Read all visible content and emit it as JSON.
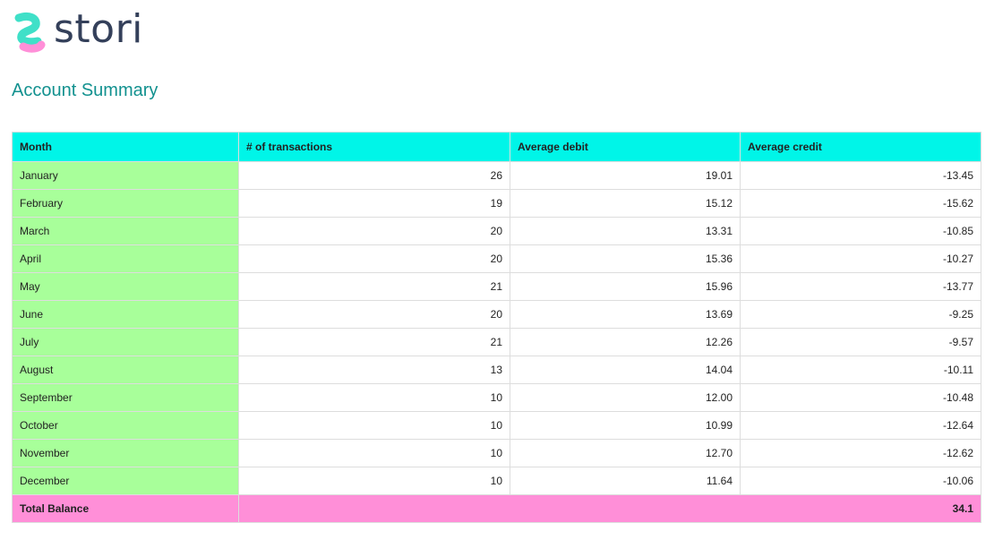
{
  "brand": {
    "name": "stori",
    "text_color": "#34405a",
    "logo_colors": [
      "#3fe0c8",
      "#ff8fd8",
      "#7b61ff"
    ]
  },
  "page": {
    "title": "Account Summary",
    "title_color": "#12918f"
  },
  "table": {
    "header_bg": "#00f5e8",
    "month_col_bg": "#a8ff9a",
    "footer_bg": "#ff8fd8",
    "columns": [
      "Month",
      "# of transactions",
      "Average debit",
      "Average credit"
    ],
    "rows": [
      [
        "January",
        "26",
        "19.01",
        "-13.45"
      ],
      [
        "February",
        "19",
        "15.12",
        "-15.62"
      ],
      [
        "March",
        "20",
        "13.31",
        "-10.85"
      ],
      [
        "April",
        "20",
        "15.36",
        "-10.27"
      ],
      [
        "May",
        "21",
        "15.96",
        "-13.77"
      ],
      [
        "June",
        "20",
        "13.69",
        "-9.25"
      ],
      [
        "July",
        "21",
        "12.26",
        "-9.57"
      ],
      [
        "August",
        "13",
        "14.04",
        "-10.11"
      ],
      [
        "September",
        "10",
        "12.00",
        "-10.48"
      ],
      [
        "October",
        "10",
        "10.99",
        "-12.64"
      ],
      [
        "November",
        "10",
        "12.70",
        "-12.62"
      ],
      [
        "December",
        "10",
        "11.64",
        "-10.06"
      ]
    ],
    "total": {
      "label": "Total Balance",
      "value": "34.1"
    }
  }
}
